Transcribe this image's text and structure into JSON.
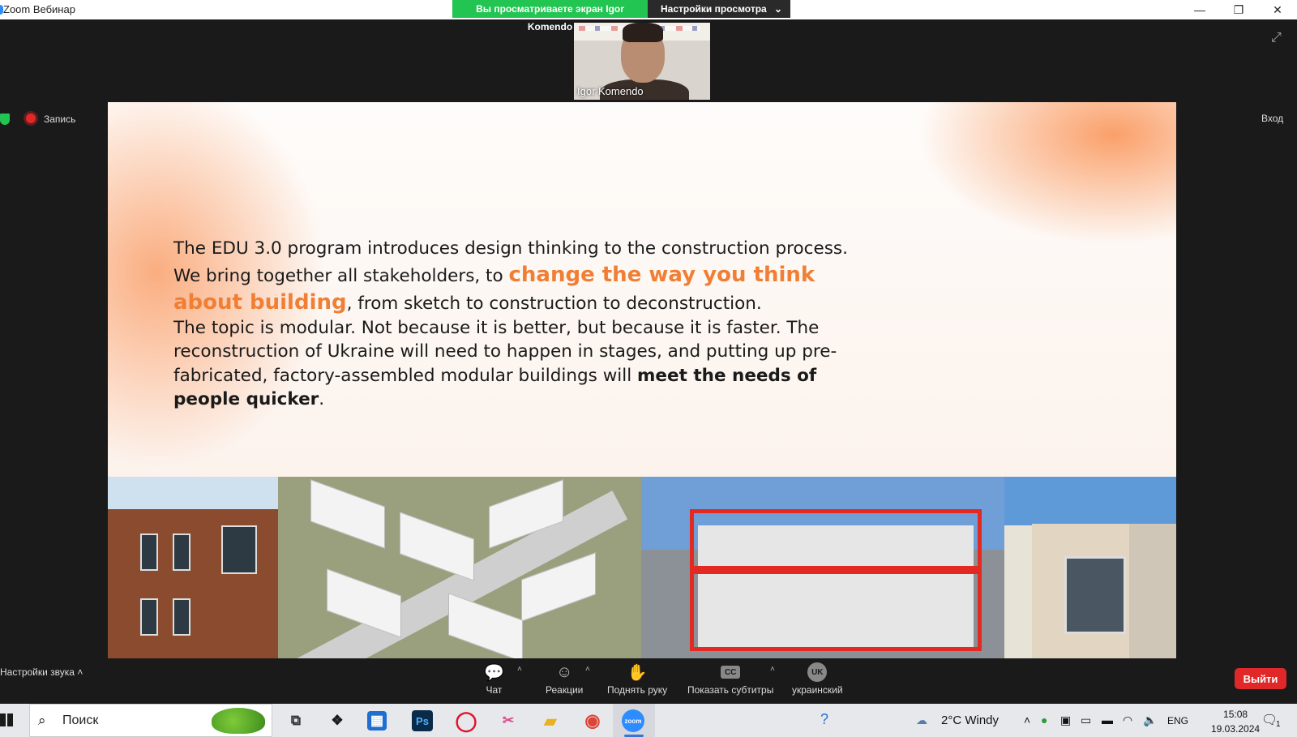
{
  "window": {
    "title": "Zoom Вебинар",
    "viewing_banner": "Вы просматриваете экран Igor Komendo",
    "view_options": "Настройки просмотра",
    "controls": [
      "—",
      "❐",
      "✕"
    ]
  },
  "participant": {
    "name": "Igor Komendo"
  },
  "indicators": {
    "recording": "Запись",
    "sign_in": "Вход"
  },
  "slide": {
    "line1": "The EDU 3.0 program introduces design thinking to the construction process.",
    "line2_start": "We bring together all stakeholders, to ",
    "line2_highlight": "change the way you think about building",
    "line2_end": ", from sketch to construction to deconstruction.",
    "line3_start": "The topic is modular. Not because it is better, but because it is faster. The reconstruction of Ukraine will need to happen in stages, and putting up pre-fabricated, factory-assembled modular buildings will ",
    "line3_bold": "meet the needs of people quicker",
    "line3_end": ".",
    "highlight_color": "#f07f35"
  },
  "controls": {
    "audio_settings": "Настройки звука",
    "chat": "Чат",
    "reactions": "Реакции",
    "raise_hand": "Поднять руку",
    "captions": "Показать субтитры",
    "captions_icon": "CC",
    "language_badge": "UK",
    "language": "украинский",
    "leave": "Выйти",
    "leave_color": "#e02828"
  },
  "taskbar": {
    "search_placeholder": "Поиск",
    "weather": "2°C  Windy",
    "language": "ENG",
    "time": "15:08",
    "date": "19.03.2024",
    "notification_count": "1",
    "apps": [
      "task-view",
      "dropbox",
      "microsoft-store",
      "photoshop",
      "opera",
      "snipping-tool",
      "file-explorer",
      "chrome",
      "zoom"
    ]
  }
}
